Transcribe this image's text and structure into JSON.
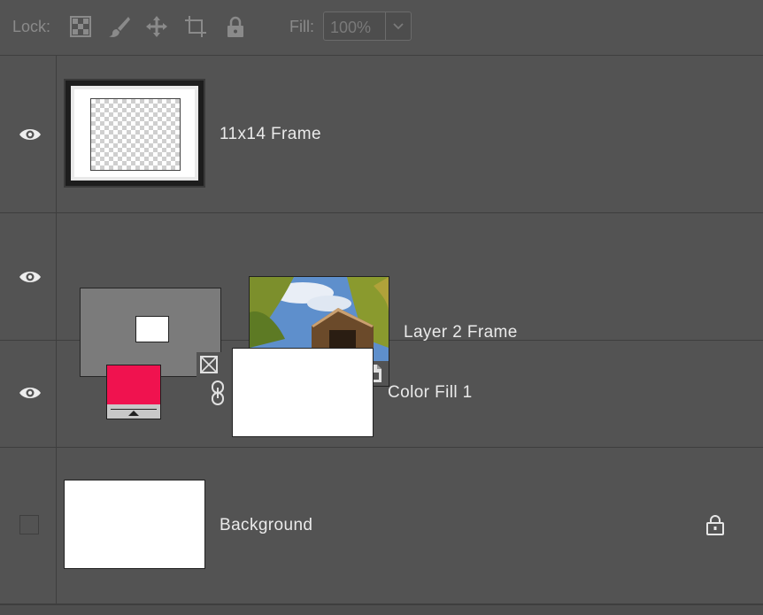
{
  "toolbar": {
    "lock_label": "Lock:",
    "lock_icons": [
      "lock-transparent-pixels-icon",
      "lock-image-pixels-icon",
      "lock-position-icon",
      "lock-artboard-icon",
      "lock-all-icon"
    ],
    "fill_label": "Fill:",
    "fill_value": "100%"
  },
  "layers": [
    {
      "name": "11x14 Frame",
      "visible": true,
      "thumbnail": "frame-thumbnail"
    },
    {
      "name": "Layer 2 Frame",
      "visible": true,
      "thumbnail": "photo-thumbnail",
      "badges": [
        "frame-badge-icon",
        "smart-object-badge-icon"
      ]
    },
    {
      "name": "Color Fill 1",
      "visible": true,
      "fill_color": "#f0124f",
      "mask": "white"
    },
    {
      "name": "Background",
      "visible": false,
      "locked": true
    }
  ],
  "colors": {
    "panel_bg": "#535353",
    "divider": "#3e3e3e",
    "fill_swatch": "#f0124f"
  }
}
